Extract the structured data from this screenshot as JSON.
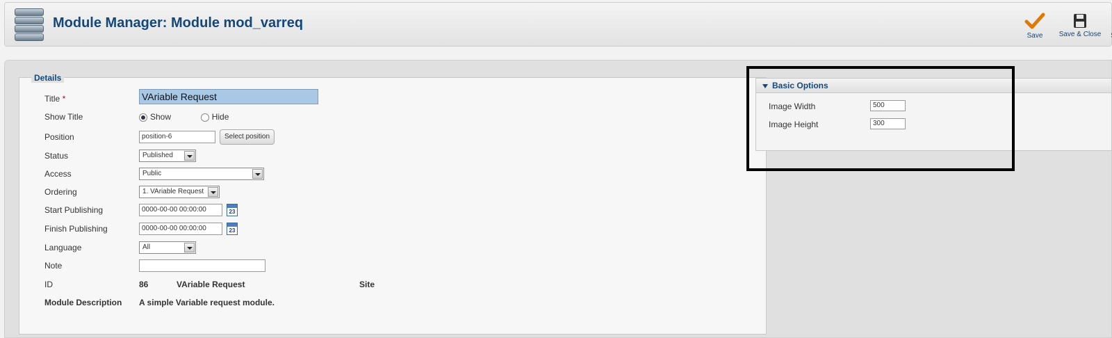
{
  "header": {
    "title": "Module Manager: Module mod_varreq",
    "icon": "module-stack-icon",
    "toolbar": {
      "save_label": "Save",
      "save_close_label": "Save & Close",
      "cut_label": "S"
    }
  },
  "details": {
    "legend": "Details",
    "title_label": "Title",
    "required_mark": "*",
    "title_value": "VAriable Request",
    "show_title_label": "Show Title",
    "show_option": "Show",
    "hide_option": "Hide",
    "show_title_selected": "Show",
    "position_label": "Position",
    "position_value": "position-6",
    "select_position_label": "Select position",
    "status_label": "Status",
    "status_value": "Published",
    "access_label": "Access",
    "access_value": "Public",
    "ordering_label": "Ordering",
    "ordering_value": "1. VAriable Request",
    "start_publishing_label": "Start Publishing",
    "start_publishing_value": "0000-00-00 00:00:00",
    "finish_publishing_label": "Finish Publishing",
    "finish_publishing_value": "0000-00-00 00:00:00",
    "calendar_text": "23",
    "language_label": "Language",
    "language_value": "All",
    "note_label": "Note",
    "note_value": "",
    "id_label": "ID",
    "id_value": "86",
    "id_module_name": "VAriable Request",
    "id_client": "Site",
    "description_label": "Module Description",
    "description_value": "A simple Variable request module."
  },
  "basic_options": {
    "heading": "Basic Options",
    "image_width_label": "Image Width",
    "image_width_value": "500",
    "image_height_label": "Image Height",
    "image_height_value": "300"
  }
}
